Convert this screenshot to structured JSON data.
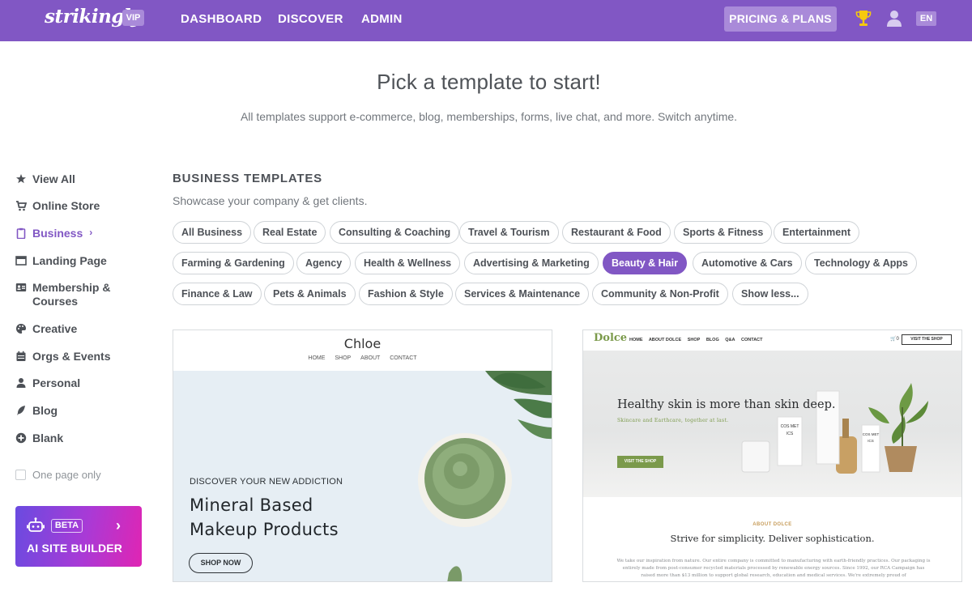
{
  "header": {
    "logo": "strikingly",
    "vip_badge": "VIP",
    "nav": [
      "DASHBOARD",
      "DISCOVER",
      "ADMIN"
    ],
    "pricing_label": "PRICING & PLANS",
    "language": "EN",
    "icons": [
      "trophy-icon",
      "user-icon"
    ]
  },
  "hero": {
    "title": "Pick a template to start!",
    "subtitle": "All templates support e-commerce, blog, memberships, forms, live chat, and more. Switch anytime."
  },
  "sidebar": {
    "items": [
      {
        "label": "View All",
        "icon": "star-icon"
      },
      {
        "label": "Online Store",
        "icon": "cart-icon"
      },
      {
        "label": "Business",
        "icon": "clipboard-icon",
        "active": true
      },
      {
        "label": "Landing Page",
        "icon": "window-icon"
      },
      {
        "label": "Membership & Courses",
        "icon": "id-card-icon"
      },
      {
        "label": "Creative",
        "icon": "palette-icon"
      },
      {
        "label": "Orgs & Events",
        "icon": "calendar-icon"
      },
      {
        "label": "Personal",
        "icon": "person-icon"
      },
      {
        "label": "Blog",
        "icon": "feather-icon"
      },
      {
        "label": "Blank",
        "icon": "plus-circle-icon"
      }
    ],
    "one_page_label": "One page only",
    "ai_builder": {
      "badge": "BETA",
      "label": "AI SITE BUILDER"
    }
  },
  "content": {
    "section_title": "BUSINESS TEMPLATES",
    "section_subtitle": "Showcase your company & get clients.",
    "filters": [
      "All Business",
      "Real Estate",
      "Consulting & Coaching",
      "Travel & Tourism",
      "Restaurant & Food",
      "Sports & Fitness",
      "Entertainment",
      "Farming & Gardening",
      "Agency",
      "Health & Wellness",
      "Advertising & Marketing",
      "Beauty & Hair",
      "Automotive & Cars",
      "Technology & Apps",
      "Finance & Law",
      "Pets & Animals",
      "Fashion & Style",
      "Services & Maintenance",
      "Community & Non-Profit",
      "Show less..."
    ],
    "active_filter": "Beauty & Hair",
    "templates": [
      {
        "name": "Chloe",
        "nav": [
          "HOME",
          "SHOP",
          "ABOUT",
          "CONTACT"
        ],
        "kicker": "DISCOVER YOUR NEW ADDICTION",
        "headline_line1": "Mineral Based",
        "headline_line2": "Makeup Products",
        "button": "SHOP NOW"
      },
      {
        "name": "Dolce",
        "nav": [
          "HOME",
          "ABOUT DOLCE",
          "SHOP",
          "BLOG",
          "Q&A",
          "CONTACT"
        ],
        "cart": "0",
        "visit_button": "VISIT THE SHOP",
        "headline": "Healthy skin is more than skin deep.",
        "tagline": "Skincare and Earthcare, together at last.",
        "hero_button": "VISIT THE SHOP",
        "box_label": "COS MET ICS",
        "about_label": "ABOUT DOLCE",
        "strive": "Strive for simplicity. Deliver sophistication.",
        "paragraph": "We take our inspiration from nature. Our entire company is committed to manufacturing with earth-friendly practices. Our packaging is entirely made from post-consumer recycled materials processed by renewable energy sources. Since 1992, our RCA Campaign has raised more than $13 million to support global research, education and medical services. We're extremely proud of"
      }
    ]
  }
}
